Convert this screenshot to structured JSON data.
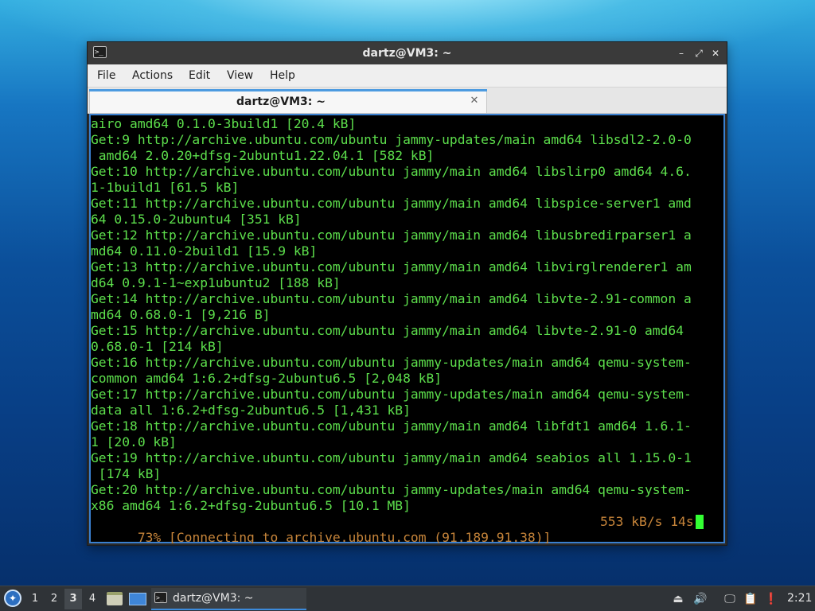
{
  "window": {
    "title": "dartz@VM3: ~",
    "app_icon": ">_",
    "controls": {
      "minimize": "–",
      "maximize": "⤢",
      "close": "✕"
    }
  },
  "menubar": {
    "items": [
      "File",
      "Actions",
      "Edit",
      "View",
      "Help"
    ]
  },
  "tabs": {
    "active_label": "dartz@VM3: ~",
    "close_glyph": "✕"
  },
  "terminal": {
    "lines": [
      "airo amd64 0.1.0-3build1 [20.4 kB]",
      "Get:9 http://archive.ubuntu.com/ubuntu jammy-updates/main amd64 libsdl2-2.0-0",
      " amd64 2.0.20+dfsg-2ubuntu1.22.04.1 [582 kB]",
      "Get:10 http://archive.ubuntu.com/ubuntu jammy/main amd64 libslirp0 amd64 4.6.",
      "1-1build1 [61.5 kB]",
      "Get:11 http://archive.ubuntu.com/ubuntu jammy/main amd64 libspice-server1 amd",
      "64 0.15.0-2ubuntu4 [351 kB]",
      "Get:12 http://archive.ubuntu.com/ubuntu jammy/main amd64 libusbredirparser1 a",
      "md64 0.11.0-2build1 [15.9 kB]",
      "Get:13 http://archive.ubuntu.com/ubuntu jammy/main amd64 libvirglrenderer1 am",
      "d64 0.9.1-1~exp1ubuntu2 [188 kB]",
      "Get:14 http://archive.ubuntu.com/ubuntu jammy/main amd64 libvte-2.91-common a",
      "md64 0.68.0-1 [9,216 B]",
      "Get:15 http://archive.ubuntu.com/ubuntu jammy/main amd64 libvte-2.91-0 amd64",
      "0.68.0-1 [214 kB]",
      "Get:16 http://archive.ubuntu.com/ubuntu jammy-updates/main amd64 qemu-system-",
      "common amd64 1:6.2+dfsg-2ubuntu6.5 [2,048 kB]",
      "Get:17 http://archive.ubuntu.com/ubuntu jammy-updates/main amd64 qemu-system-",
      "data all 1:6.2+dfsg-2ubuntu6.5 [1,431 kB]",
      "Get:18 http://archive.ubuntu.com/ubuntu jammy/main amd64 libfdt1 amd64 1.6.1-",
      "1 [20.0 kB]",
      "Get:19 http://archive.ubuntu.com/ubuntu jammy/main amd64 seabios all 1.15.0-1",
      " [174 kB]",
      "Get:20 http://archive.ubuntu.com/ubuntu jammy-updates/main amd64 qemu-system-",
      "x86 amd64 1:6.2+dfsg-2ubuntu6.5 [10.1 MB]"
    ],
    "status": {
      "progress_text": "73% [Connecting to archive.ubuntu.com (91.189.91.38)]",
      "rate_text": "553 kB/s 14s"
    },
    "colors": {
      "text": "#5ddf4c",
      "status": "#c7853a",
      "cursor": "#33ff33",
      "background": "#000000"
    }
  },
  "panel": {
    "start_icon": "start-menu-icon",
    "workspaces": [
      "1",
      "2",
      "3",
      "4"
    ],
    "active_workspace": "3",
    "launchers": [
      "file-manager-icon",
      "show-desktop-icon"
    ],
    "task": {
      "label": "dartz@VM3: ~",
      "icon": ">_"
    },
    "tray": [
      "eject-icon",
      "volume-icon",
      "network-icon",
      "clipboard-icon",
      "notification-icon"
    ],
    "clock": "2:21"
  }
}
